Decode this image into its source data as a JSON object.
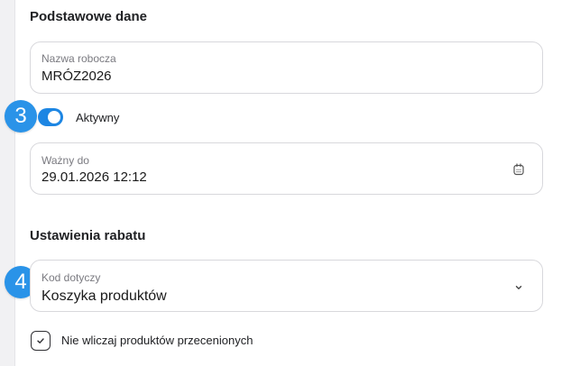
{
  "section_basic": {
    "title": "Podstawowe dane"
  },
  "name_field": {
    "label": "Nazwa robocza",
    "value": "MRÓZ2026"
  },
  "active_toggle": {
    "label": "Aktywny",
    "checked": true
  },
  "valid_until_field": {
    "label": "Ważny do",
    "value": "29.01.2026 12:12",
    "icon": "calendar-icon"
  },
  "section_discount": {
    "title": "Ustawienia rabatu"
  },
  "applies_to_field": {
    "label": "Kod dotyczy",
    "value": "Koszyka produktów",
    "icon": "chevron-down-icon"
  },
  "exclude_discounted_checkbox": {
    "label": "Nie wliczaj produktów przecenionych",
    "checked": true
  },
  "step_badges": {
    "toggle_step": "3",
    "applies_to_step": "4"
  },
  "colors": {
    "accent": "#1d86e3",
    "badge": "#2a93e8",
    "border": "#d8d8dc",
    "label": "#7a7a80"
  }
}
